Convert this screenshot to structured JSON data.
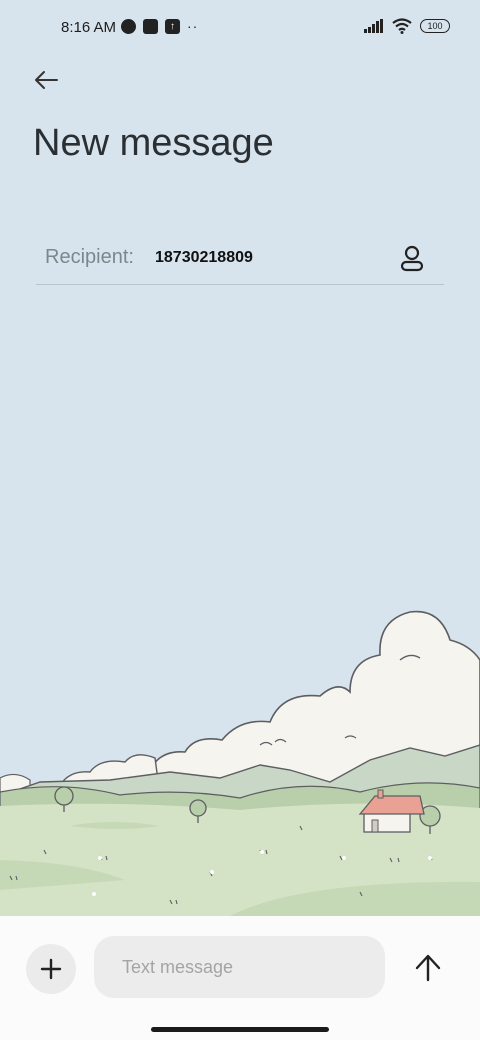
{
  "status_bar": {
    "time": "8:16 AM",
    "battery": "100",
    "icons": [
      "notification-app-icon",
      "square-app-icon",
      "upload-icon",
      "more-dots-icon",
      "signal-icon",
      "wifi-icon",
      "battery-icon"
    ]
  },
  "header": {
    "back_icon": "back-arrow-icon",
    "title": "New message"
  },
  "recipient": {
    "label": "Recipient:",
    "value": "18730218809",
    "contact_icon": "contact-person-icon"
  },
  "composer": {
    "add_icon": "plus-icon",
    "placeholder": "Text message",
    "send_icon": "send-arrow-icon"
  },
  "colors": {
    "background": "#d8e4ed",
    "bottom_bar": "#fbfbfb",
    "input_bg": "#ececec"
  }
}
